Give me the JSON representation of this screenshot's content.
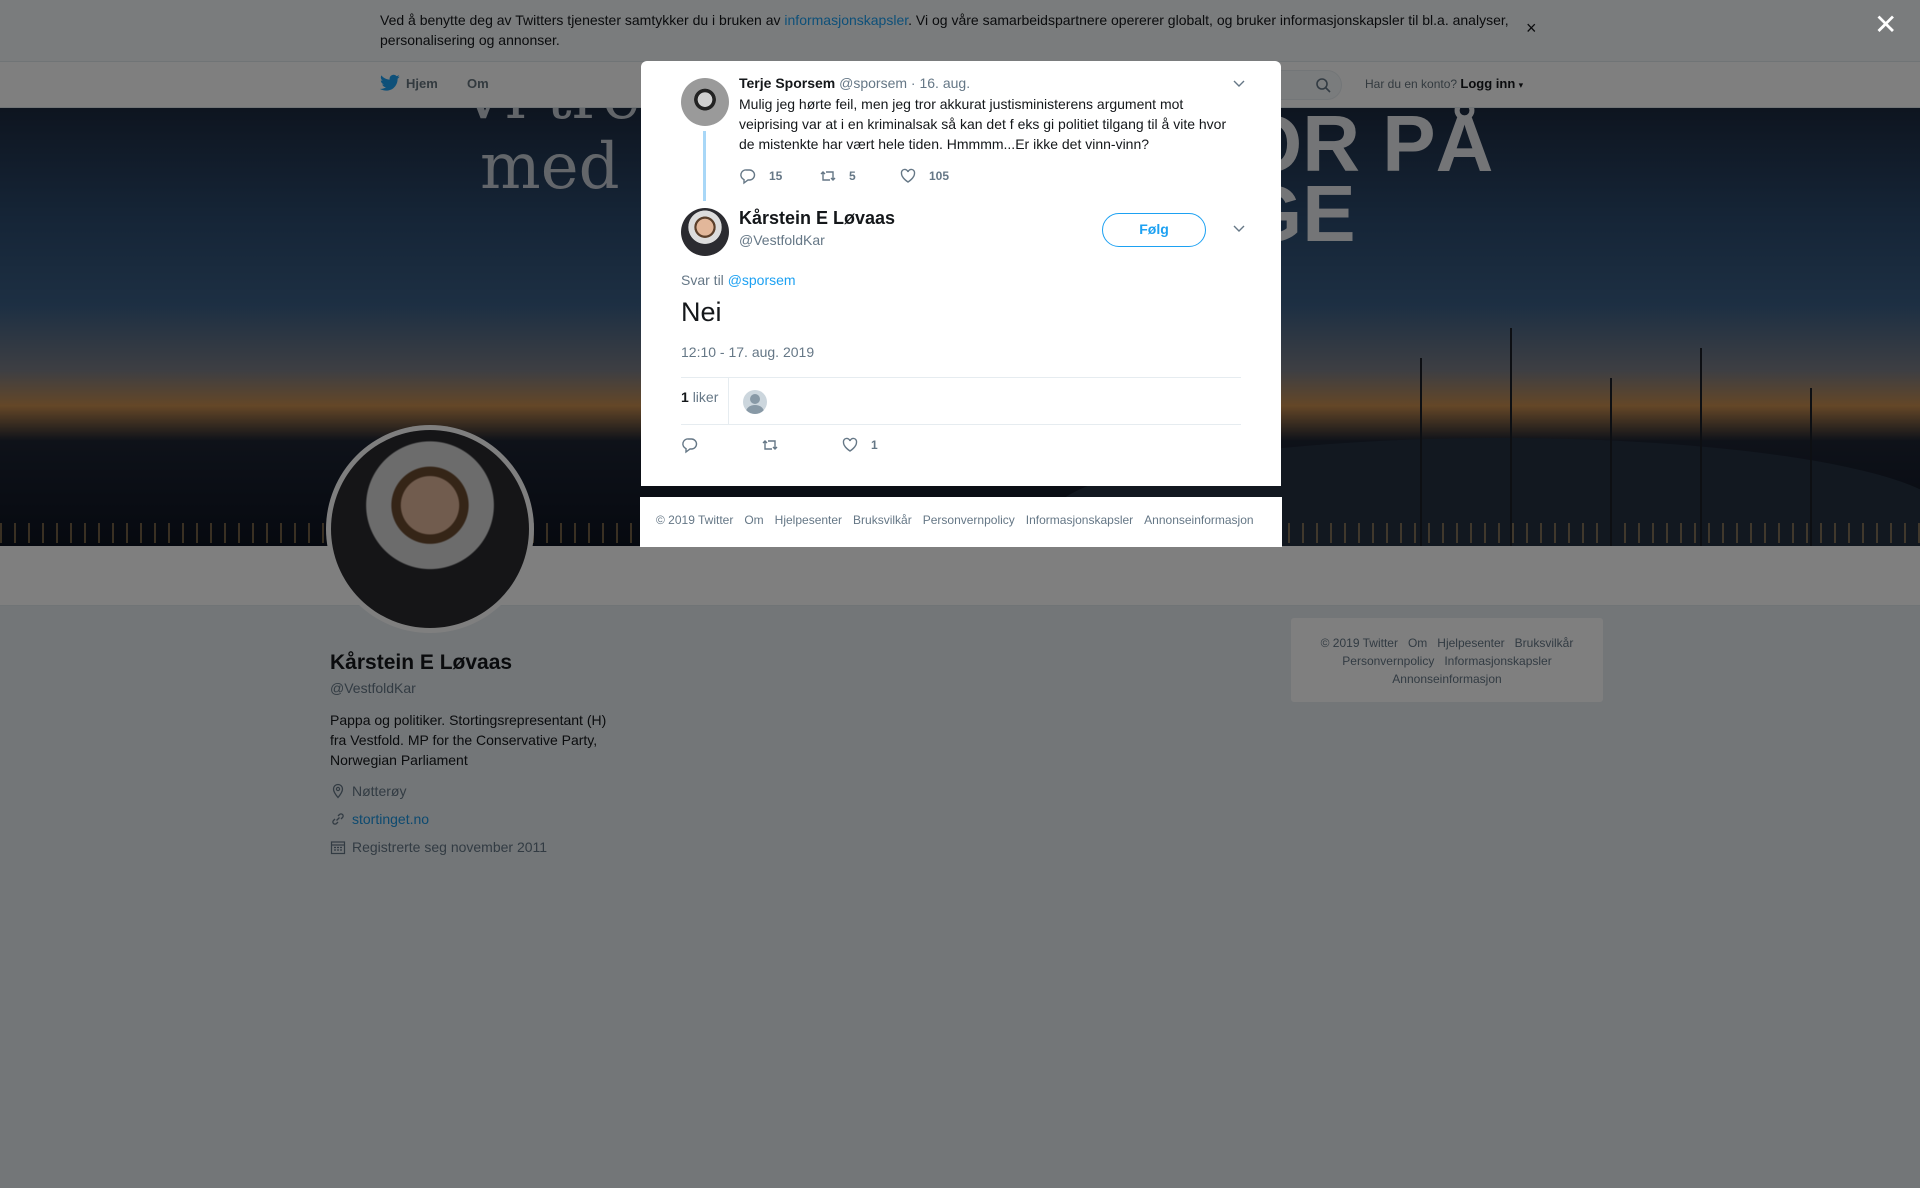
{
  "cookie": {
    "text_before": "Ved å benytte deg av Twitters tjenester samtykker du i bruken av ",
    "link": "informasjonskapsler",
    "text_after": ". Vi og våre samarbeidspartnere opererer globalt, og bruker informasjonskapsler til bl.a. analyser, personalisering og annonser.",
    "close": "×"
  },
  "nav": {
    "home": "Hjem",
    "about": "Om",
    "account_prompt": "Har du en konto?",
    "login": "Logg inn"
  },
  "hero": {
    "line0": "Vi trenger",
    "line1": "med ",
    "line2": "OR PÅ",
    "line3": "GE"
  },
  "profile": {
    "name": "Kårstein E Løvaas",
    "handle": "@VestfoldKar",
    "bio": "Pappa og politiker. Stortingsrepresentant (H) fra Vestfold. MP for the Conservative Party, Norwegian Parliament",
    "location": "Nøtterøy",
    "website": "stortinget.no",
    "joined": "Registrerte seg november 2011"
  },
  "right_footer": {
    "items": [
      "© 2019 Twitter",
      "Om",
      "Hjelpesenter",
      "Bruksvilkår",
      "Personvernpolicy",
      "Informasjonskapsler",
      "Annonseinformasjon"
    ]
  },
  "overlay": {
    "close": "✕"
  },
  "modal": {
    "parent": {
      "name": "Terje Sporsem",
      "handle": "@sporsem",
      "date": "16. aug.",
      "text": "Mulig jeg hørte feil, men jeg tror akkurat justisministerens argument mot veiprising var at i en kriminalsak så kan det f eks gi politiet tilgang til å vite hvor de mistenkte har vært hele tiden. Hmmmm...Er ikke det vinn-vinn?",
      "replies": "15",
      "retweets": "5",
      "likes": "105"
    },
    "tweet": {
      "name": "Kårstein E Løvaas",
      "handle": "@VestfoldKar",
      "follow": "Følg",
      "reply_prefix": "Svar til",
      "reply_handle": "@sporsem",
      "text": "Nei",
      "timestamp": "12:10 - 17. aug. 2019",
      "like_count": "1",
      "like_label": "liker",
      "action_likes": "1"
    },
    "footer": [
      "© 2019 Twitter",
      "Om",
      "Hjelpesenter",
      "Bruksvilkår",
      "Personvernpolicy",
      "Informasjonskapsler",
      "Annonseinformasjon"
    ]
  },
  "colors": {
    "accent": "#1da1f2",
    "text": "#14171a",
    "muted": "#657786"
  }
}
